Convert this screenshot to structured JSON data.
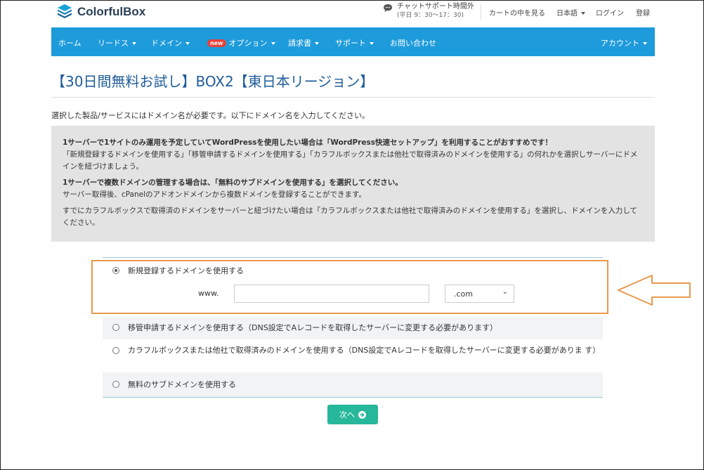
{
  "brand": {
    "name": "ColorfulBox"
  },
  "support": {
    "title": "チャットサポート時間外",
    "hours": "(平日 9：30〜17：30)"
  },
  "top_links": {
    "cart": "カートの中を見る",
    "language": "日本語",
    "login": "ログイン",
    "register": "登録"
  },
  "nav": {
    "home": "ホーム",
    "lease": "リードス",
    "domain": "ドメイン",
    "new_badge": "new",
    "options": "オプション",
    "billing": "請求書",
    "support": "サポート",
    "contact": "お問い合わせ",
    "account": "アカウント"
  },
  "page": {
    "title": "【30日間無料お試し】BOX2【東日本リージョン】",
    "intro": "選択した製品/サービスにはドメイン名が必要です。以下にドメイン名を入力してください。"
  },
  "info": {
    "p1_bold": "1サーバーで1サイトのみ運用を予定していてWordPressを使用したい場合は「WordPress快速セットアップ」を利用することがおすすめです！",
    "p1_text": "「新規登録するドメインを使用する」「移管申請するドメインを使用する」「カラフルボックスまたは他社で取得済みのドメインを使用する」の何れかを選択しサーバーにドメインを紐づけましょう。",
    "p2_bold": "1サーバーで複数ドメインの管理する場合は、「無料のサブドメインを使用する」を選択してください。",
    "p2_text": "サーバー取得後、cPanelのアドオンドメインから複数ドメインを登録することができます。",
    "p3_text": "すでにカラフルボックスで取得済のドメインをサーバーと紐づけたい場合は「カラフルボックスまたは他社で取得済みのドメインを使用する」を選択し、ドメインを入力してください。"
  },
  "options": {
    "register_new": "新規登録するドメインを使用する",
    "www_prefix": "www.",
    "domain_input_value": "",
    "tld_selected": ".com",
    "transfer": "移管申請するドメインを使用する（DNS設定でAレコードを取得したサーバーに変更する必要があります）",
    "existing": "カラフルボックスまたは他社で取得済みのドメインを使用する（DNS設定でAレコードを取得したサーバーに変更する必要がありま す）",
    "subdomain": "無料のサブドメインを使用する"
  },
  "next_button": {
    "label": "次へ"
  },
  "colors": {
    "nav": "#1d9bdb",
    "title": "#1f5c99",
    "button": "#27b79a",
    "highlight": "#e89a4e"
  }
}
